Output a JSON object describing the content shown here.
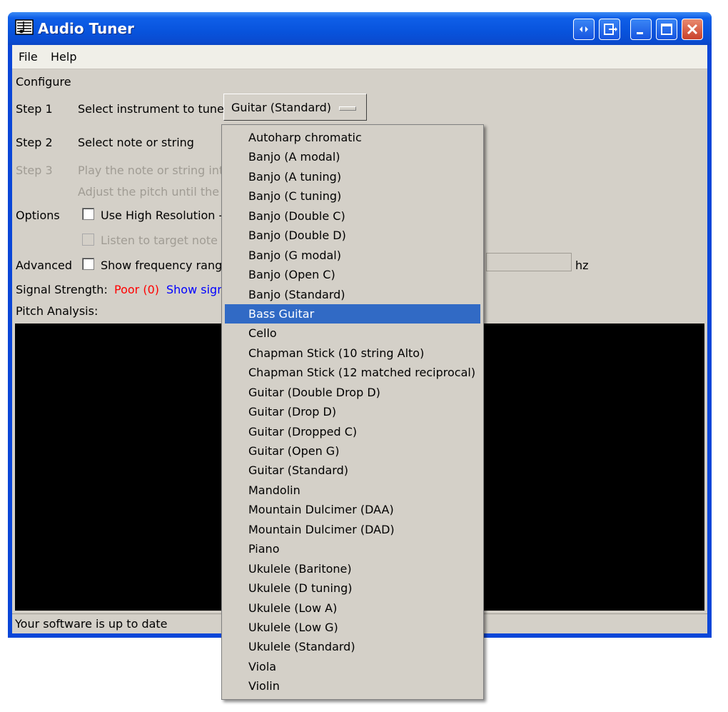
{
  "window": {
    "title": "Audio Tuner"
  },
  "menu": {
    "file": "File",
    "help": "Help"
  },
  "configure_label": "Configure",
  "step1": {
    "label": "Step 1",
    "text": "Select instrument to tune",
    "selected": "Guitar (Standard)"
  },
  "step2": {
    "label": "Step 2",
    "text": "Select note or string"
  },
  "step3": {
    "label": "Step 3",
    "text": "Play the note or string into",
    "text2": "Adjust the pitch until the p"
  },
  "options": {
    "label": "Options",
    "high_res": "Use High Resolution -",
    "listen": "Listen to target note"
  },
  "advanced": {
    "label": "Advanced",
    "show_freq": "Show frequency range",
    "unit": "hz"
  },
  "signal": {
    "label": "Signal Strength:",
    "value": "Poor (0)",
    "link": "Show sign",
    "value_color": "#ff0000",
    "link_color": "#0000ff"
  },
  "pitch_label": "Pitch Analysis:",
  "status": "Your software is up to date",
  "instruments": [
    "Autoharp chromatic",
    "Banjo (A modal)",
    "Banjo (A tuning)",
    "Banjo (C tuning)",
    "Banjo (Double C)",
    "Banjo (Double D)",
    "Banjo (G modal)",
    "Banjo (Open C)",
    "Banjo (Standard)",
    "Bass Guitar",
    "Cello",
    "Chapman Stick (10 string Alto)",
    "Chapman Stick (12 matched reciprocal)",
    "Guitar (Double Drop D)",
    "Guitar (Drop D)",
    "Guitar (Dropped C)",
    "Guitar (Open G)",
    "Guitar (Standard)",
    "Mandolin",
    "Mountain Dulcimer (DAA)",
    "Mountain Dulcimer (DAD)",
    "Piano",
    "Ukulele (Baritone)",
    "Ukulele (D tuning)",
    "Ukulele (Low A)",
    "Ukulele (Low G)",
    "Ukulele (Standard)",
    "Viola",
    "Violin"
  ],
  "highlighted_instrument": "Bass Guitar",
  "colors": {
    "selection": "#316ac5",
    "titlebar": "#0853dc",
    "panel": "#d4d0c8"
  }
}
